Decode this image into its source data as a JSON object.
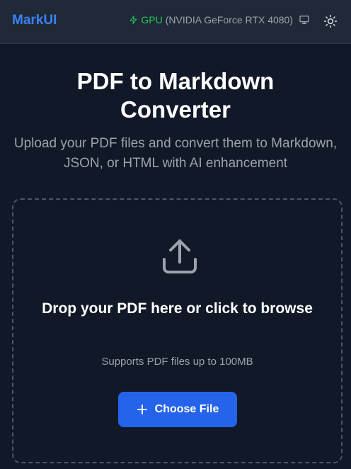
{
  "header": {
    "brand": "MarkUI",
    "gpu_label": "GPU",
    "gpu_name": "(NVIDIA GeForce RTX 4080)",
    "gpu_icon": "bolt-icon",
    "monitor_icon": "monitor-icon",
    "theme_icon": "sun-icon"
  },
  "main": {
    "title": "PDF to Markdown Converter",
    "subtitle": "Upload your PDF files and convert them to Markdown, JSON, or HTML with AI enhancement"
  },
  "dropzone": {
    "icon": "upload-icon",
    "title": "Drop your PDF here or click to browse",
    "subtitle": "Supports PDF files up to 100MB",
    "button_label": "Choose File",
    "button_icon": "plus-icon"
  },
  "colors": {
    "background": "#111827",
    "header_bg": "#1f2937",
    "brand": "#3b82f6",
    "gpu_accent": "#22c55e",
    "button": "#2563eb",
    "muted_text": "#9ca3af"
  }
}
